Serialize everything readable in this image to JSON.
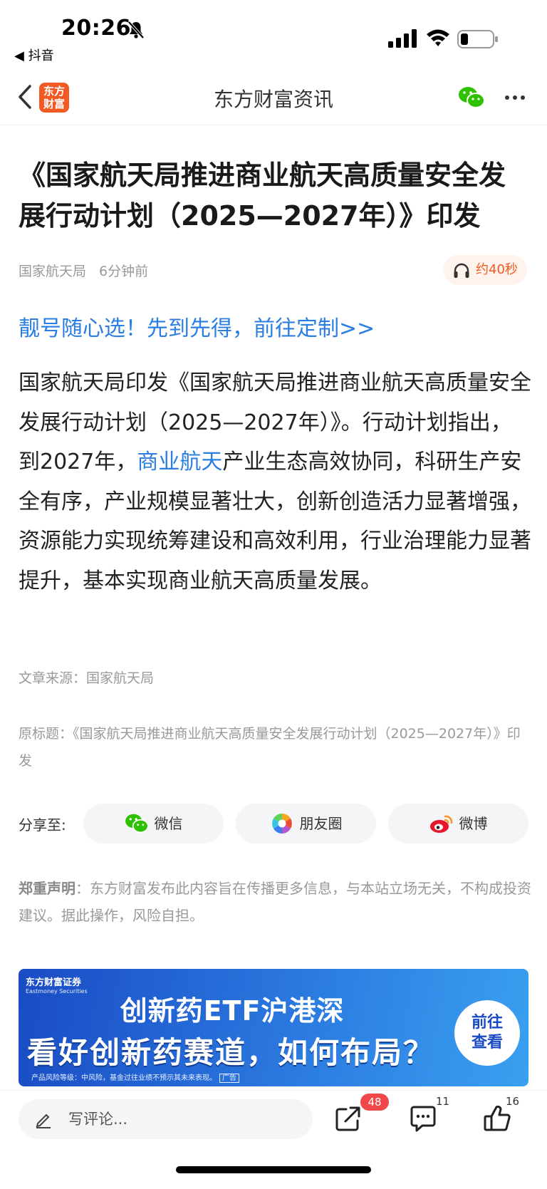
{
  "status_bar": {
    "time": "20:26",
    "back_app": "◀ 抖音"
  },
  "nav": {
    "logo_text": "东方财富",
    "title": "东方财富资讯"
  },
  "article": {
    "headline": "《国家航天局推进商业航天高质量安全发展行动计划（2025—2027年）》印发",
    "source_name": "国家航天局",
    "time_ago": "6分钟前",
    "audio_duration": "约40秒",
    "promo_link": "靓号随心选！先到先得，前往定制>>",
    "body_before": "国家航天局印发《国家航天局推进商业航天高质量安全发展行动计划（2025—2027年）》。行动计划指出，到2027年，",
    "body_link": "商业航天",
    "body_after": "产业生态高效协同，科研生产安全有序，产业规模显著壮大，创新创造活力显著增强，资源能力实现统筹建设和高效利用，行业治理能力显著提升，基本实现商业航天高质量发展。",
    "source_line": "文章来源：国家航天局",
    "original_title": "原标题：《国家航天局推进商业航天高质量安全发展行动计划（2025—2027年）》印发"
  },
  "share": {
    "label": "分享至:",
    "wechat": "微信",
    "moments": "朋友圈",
    "weibo": "微博"
  },
  "disclaimer": {
    "title": "郑重声明",
    "text": "：东方财富发布此内容旨在传播更多信息，与本站立场无关，不构成投资建议。据此操作，风险自担。"
  },
  "ad": {
    "brand": "东方财富证券",
    "brand_en": "Eastmoney Securities",
    "line1": "创新药ETF沪港深",
    "line2": "看好创新药赛道，如何布局？",
    "fine_print": "产品风险等级：中风险，基金过往业绩不预示其未来表现。",
    "ad_tag": "广告",
    "cta_line1": "前往",
    "cta_line2": "查看"
  },
  "bottom_bar": {
    "comment_placeholder": "写评论...",
    "share_count": "48",
    "comment_count": "11",
    "like_count": "16"
  },
  "colors": {
    "brand_orange": "#f15a22",
    "link_blue": "#2a7de1",
    "badge_red": "#f04848",
    "wechat_green": "#2dc100"
  },
  "icons": [
    "bell-off-icon",
    "signal-icon",
    "wifi-icon",
    "battery-icon",
    "back-arrow-icon",
    "wechat-icon",
    "more-icon",
    "headphones-icon",
    "moments-icon",
    "weibo-icon",
    "pencil-icon",
    "share-icon",
    "comment-icon",
    "like-icon"
  ]
}
